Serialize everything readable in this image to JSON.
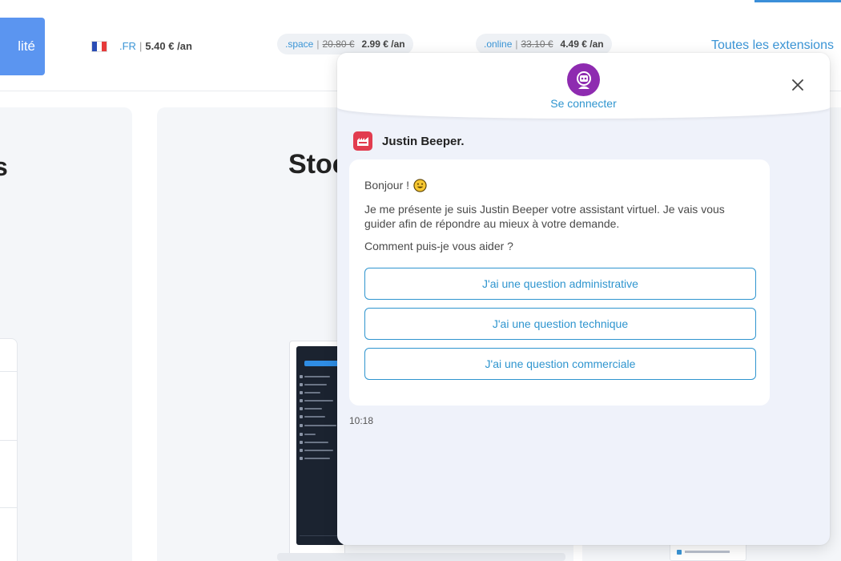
{
  "topbar": {
    "cta_label": "lité",
    "extensions": [
      {
        "name": ".FR",
        "price": "5.40 € /an"
      },
      {
        "name": ".space",
        "old_price": "20.80 €",
        "price": "2.99 € /an"
      },
      {
        "name": ".online",
        "old_price": "33.10 €",
        "price": "4.49 € /an"
      }
    ],
    "separator": "|",
    "all_extensions_label": "Toutes les extensions"
  },
  "background": {
    "left_heading_fragment": "s",
    "mid_heading_fragment": "Stoc"
  },
  "chat": {
    "connect_label": "Se connecter",
    "agent_name": "Justin Beeper.",
    "messages": {
      "greeting": "Bonjour !",
      "intro": "Je me présente je suis Justin Beeper votre assistant virtuel. Je vais vous guider afin de répondre au mieux à votre demande.",
      "question": "Comment puis-je vous aider ?"
    },
    "choices": [
      "J'ai une question administrative",
      "J'ai une question technique",
      "J'ai une question commerciale"
    ],
    "timestamp": "10:18"
  },
  "colors": {
    "accent": "#2f95cf",
    "cta": "#5b95f0",
    "bot_avatar": "#8e2bb0",
    "agent_logo": "#e23c4f",
    "chat_bg": "#eff2fa"
  },
  "icons": {
    "flag": "france-flag-icon",
    "avatar": "robot-avatar-icon",
    "close": "close-icon",
    "agent": "agent-logo-icon",
    "emoji": "smiling-face-icon"
  }
}
